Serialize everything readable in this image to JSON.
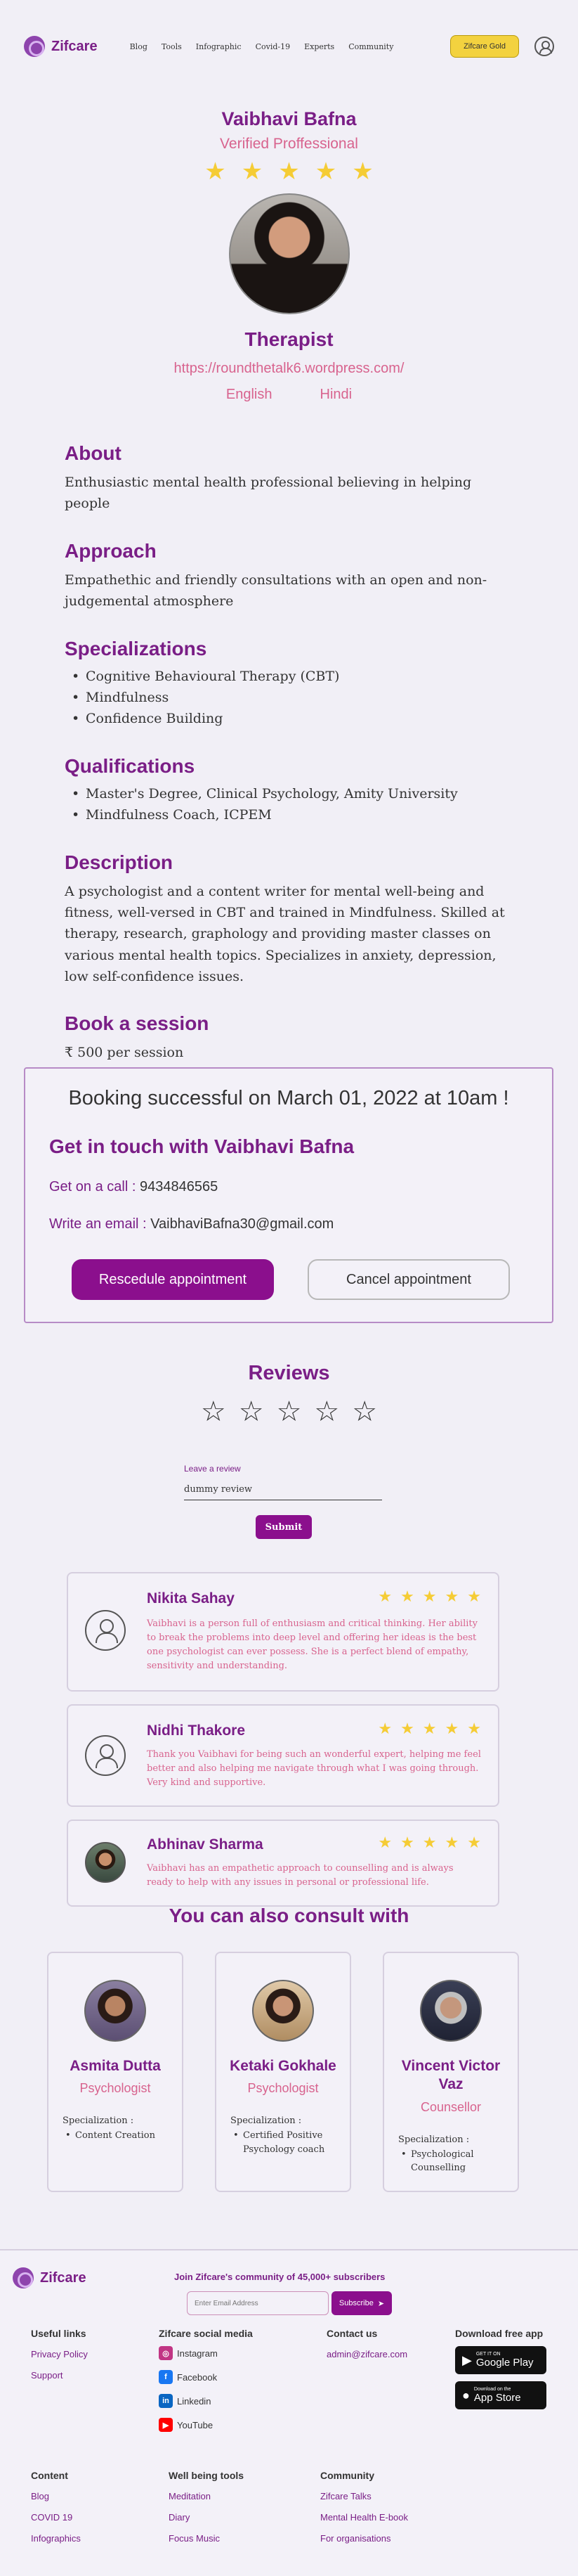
{
  "header": {
    "brand": "Zifcare",
    "nav": [
      "Blog",
      "Tools",
      "Infographic",
      "Covid-19",
      "Experts",
      "Community"
    ],
    "gold_button": "Zifcare Gold"
  },
  "profile": {
    "name": "Vaibhavi Bafna",
    "verified": "Verified Proffessional",
    "rating_stars": 5,
    "role": "Therapist",
    "website": "https://roundthetalk6.wordpress.com/",
    "languages": [
      "English",
      "Hindi"
    ]
  },
  "about": {
    "title": "About",
    "text": "Enthusiastic mental health professional believing in helping people"
  },
  "approach": {
    "title": "Approach",
    "text": "Empathethic and friendly consultations with an open and non-judgemental atmosphere"
  },
  "specializations": {
    "title": "Specializations",
    "items": [
      "Cognitive Behavioural Therapy (CBT)",
      "Mindfulness",
      "Confidence Building"
    ]
  },
  "qualifications": {
    "title": "Qualifications",
    "items": [
      "Master's Degree, Clinical Psychology, Amity University",
      "Mindfulness Coach, ICPEM"
    ]
  },
  "description": {
    "title": "Description",
    "text": "A psychologist and a content writer for mental well-being and fitness, well-versed in CBT and trained in Mindfulness. Skilled at therapy, research, graphology and providing master classes on various mental health topics. Specializes in anxiety, depression, low self-confidence issues."
  },
  "book": {
    "title": "Book a session",
    "price": "₹ 500 per session"
  },
  "booking": {
    "success": "Booking successful on March 01, 2022 at 10am !",
    "contact_title": "Get in touch with Vaibhavi Bafna",
    "call_label": "Get on a call :",
    "call_value": "9434846565",
    "email_label": "Write an email :",
    "email_value": "VaibhaviBafna30@gmail.com",
    "reschedule": "Rescedule appointment",
    "cancel": "Cancel appointment"
  },
  "reviews": {
    "title": "Reviews",
    "leave_label": "Leave a review",
    "input_value": "dummy review",
    "submit": "Submit",
    "items": [
      {
        "name": "Nikita Sahay",
        "stars": 5,
        "text": "Vaibhavi is a person full of enthusiasm and critical thinking. Her ability to break the problems into deep level and offering her ideas is the best one psychologist can ever possess. She is a perfect blend of empathy, sensitivity and understanding."
      },
      {
        "name": "Nidhi Thakore",
        "stars": 5,
        "text": "Thank you Vaibhavi for being such an wonderful expert, helping me feel better and also helping me navigate through what I was going through. Very kind and supportive."
      },
      {
        "name": "Abhinav Sharma",
        "stars": 5,
        "text": "Vaibhavi has an empathetic approach to counselling and is always ready to help with any issues in personal or professional life."
      }
    ]
  },
  "consult": {
    "title": "You can also consult with",
    "spec_label": "Specialization :",
    "people": [
      {
        "name": "Asmita Dutta",
        "role": "Psychologist",
        "specs": [
          "Content Creation"
        ]
      },
      {
        "name": "Ketaki Gokhale",
        "role": "Psychologist",
        "specs": [
          "Certified Positive Psychology coach"
        ]
      },
      {
        "name": "Vincent Victor Vaz",
        "role": "Counsellor",
        "specs": [
          "Psychological Counselling"
        ]
      }
    ]
  },
  "footer": {
    "brand": "Zifcare",
    "join": "Join Zifcare's community of 45,000+ subscribers",
    "email_placeholder": "Enter Email Address",
    "subscribe": "Subscribe",
    "useful_title": "Useful links",
    "useful_links": [
      "Privacy Policy",
      "Support"
    ],
    "social_title": "Zifcare social media",
    "social": [
      "Instagram",
      "Facebook",
      "Linkedin",
      "YouTube"
    ],
    "contact_title": "Contact us",
    "contact_email": "admin@zifcare.com",
    "download_title": "Download free app",
    "google_small": "GET IT ON",
    "google_big": "Google Play",
    "apple_small": "Download on the",
    "apple_big": "App Store",
    "content_title": "Content",
    "content_links": [
      "Blog",
      "COVID 19",
      "Infographics"
    ],
    "wellbeing_title": "Well being tools",
    "wellbeing_links": [
      "Meditation",
      "Diary",
      "Focus Music"
    ],
    "community_title": "Community",
    "community_links": [
      "Zifcare Talks",
      "Mental Health E-book",
      "For organisations"
    ]
  }
}
